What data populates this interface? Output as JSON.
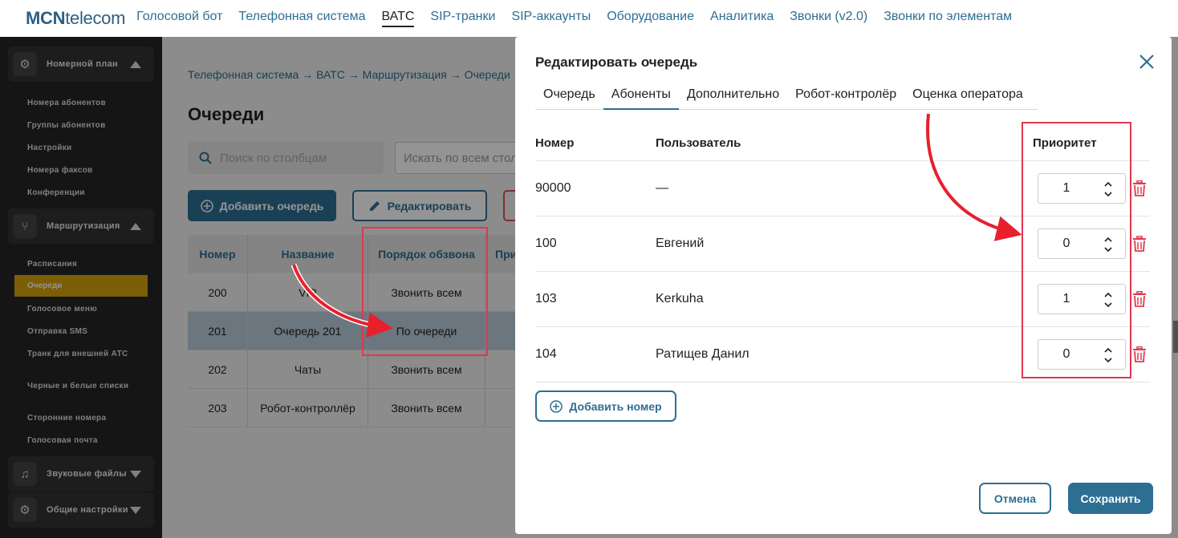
{
  "brand": {
    "bold": "MCN",
    "light": "telecom"
  },
  "topnav": [
    "Голосовой бот",
    "Телефонная система",
    "ВАТС",
    "SIP-транки",
    "SIP-аккаунты",
    "Оборудование",
    "Аналитика",
    "Звонки (v2.0)",
    "Звонки по элементам"
  ],
  "sidebar": {
    "numbering_plan": "Номерной план",
    "numbering_items": [
      "Номера абонентов",
      "Группы абонентов",
      "Настройки",
      "Номера факсов",
      "Конференции"
    ],
    "routing": "Маршрутизация",
    "routing_items": [
      "Расписания",
      "Очереди",
      "Голосовое меню",
      "Отправка SMS",
      "Транк для внешней АТС",
      "Черные и белые списки",
      "Сторонние номера",
      "Голосовая почта"
    ],
    "sound_files": "Звуковые файлы",
    "general_settings": "Общие настройки"
  },
  "breadcrumb": "Телефонная система → ВАТС → Маршрутизация → Очереди",
  "page_title": "Очереди",
  "search": {
    "columns_placeholder": "Поиск по столбцам",
    "all_placeholder": "Искать по всем столбцам"
  },
  "toolbar": {
    "add_queue": "Добавить очередь",
    "edit": "Редактировать"
  },
  "queue_table": {
    "headers": [
      "Номер",
      "Название",
      "Порядок обзвона",
      "При"
    ],
    "rows": [
      {
        "number": "200",
        "name": "VIP",
        "order": "Звонить всем"
      },
      {
        "number": "201",
        "name": "Очередь 201",
        "order": "По очереди"
      },
      {
        "number": "202",
        "name": "Чаты",
        "order": "Звонить всем"
      },
      {
        "number": "203",
        "name": "Робот-контроллёр",
        "order": "Звонить всем"
      }
    ]
  },
  "modal": {
    "title": "Редактировать очередь",
    "tabs": [
      "Очередь",
      "Абоненты",
      "Дополнительно",
      "Робот-контролёр",
      "Оценка оператора"
    ],
    "headers": {
      "number": "Номер",
      "user": "Пользователь",
      "priority": "Приоритет"
    },
    "rows": [
      {
        "number": "90000",
        "user": "—",
        "priority": "1"
      },
      {
        "number": "100",
        "user": "Евгений",
        "priority": "0"
      },
      {
        "number": "103",
        "user": "Kerkuha",
        "priority": "1"
      },
      {
        "number": "104",
        "user": "Ратищев Данил",
        "priority": "0"
      }
    ],
    "add_number": "Добавить номер",
    "cancel": "Отмена",
    "save": "Сохранить"
  },
  "colors": {
    "accent": "#2d6f93",
    "highlight": "#e0384e",
    "sidebar_active": "#d6a20c"
  }
}
